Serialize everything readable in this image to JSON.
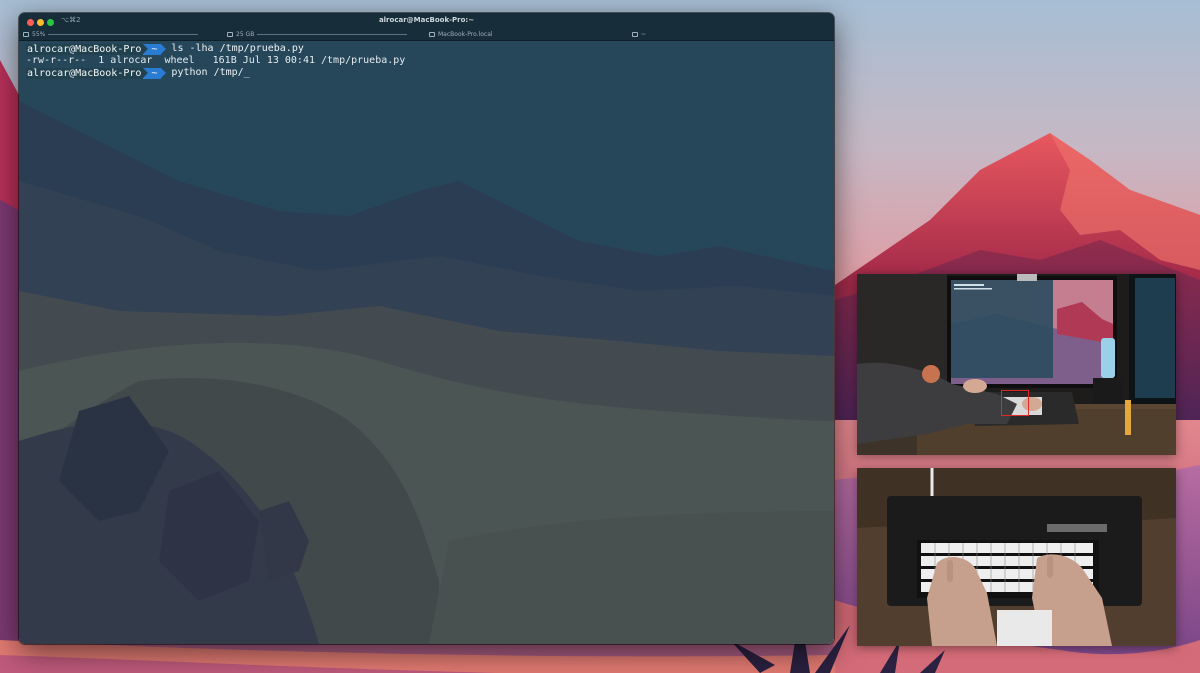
{
  "window": {
    "title": "alrocar@MacBook-Pro:~",
    "tab_shortcut": "⌥⌘2"
  },
  "statusbar": {
    "battery": "55%",
    "disk": "25 GB",
    "host": "MacBook-Pro.local",
    "cwd": "~"
  },
  "terminal": {
    "lines": [
      {
        "user": "alrocar@MacBook-Pro",
        "dir": "~",
        "command": "ls -lha /tmp/prueba.py"
      },
      {
        "output": "-rw-r--r--  1 alrocar  wheel   161B Jul 13 00:41 /tmp/prueba.py"
      },
      {
        "user": "alrocar@MacBook-Pro",
        "dir": "~",
        "command": "python /tmp/",
        "cursor": "_"
      }
    ]
  },
  "colors": {
    "prompt_user_bg": "#22414f",
    "prompt_dir_bg": "#2a7bd2",
    "focus_box": "#e02a2a"
  },
  "icons": {
    "battery": "battery-icon",
    "disk": "disk-icon",
    "host": "laptop-icon",
    "cwd": "folder-icon"
  }
}
